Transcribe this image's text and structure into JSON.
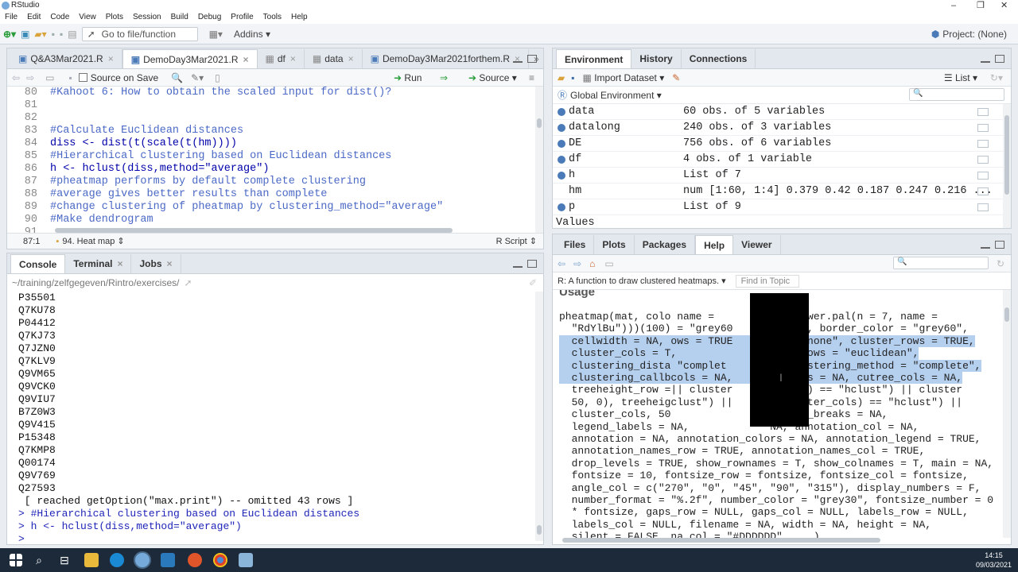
{
  "window": {
    "title": "RStudio"
  },
  "menu": [
    "File",
    "Edit",
    "Code",
    "View",
    "Plots",
    "Session",
    "Build",
    "Debug",
    "Profile",
    "Tools",
    "Help"
  ],
  "toolbar": {
    "goto_placeholder": "Go to file/function",
    "addins": "Addins",
    "project": "Project: (None)"
  },
  "editor": {
    "tabs": [
      "Q&A3Mar2021.R",
      "DemoDay3Mar2021.R",
      "df",
      "data",
      "DemoDay3Mar2021forthem.R"
    ],
    "source_on_save": "Source on Save",
    "run": "Run",
    "source": "Source",
    "lines": [
      {
        "n": "80",
        "text": "#Kahoot 6: How to obtain the scaled input for dist()?",
        "kind": "comment"
      },
      {
        "n": "81",
        "text": "",
        "kind": "code"
      },
      {
        "n": "82",
        "text": "",
        "kind": "code"
      },
      {
        "n": "83",
        "text": "#Calculate Euclidean distances",
        "kind": "comment"
      },
      {
        "n": "84",
        "text": "diss <- dist(t(scale(t(hm))))",
        "kind": "code"
      },
      {
        "n": "85",
        "text": "#Hierarchical clustering based on Euclidean distances",
        "kind": "comment"
      },
      {
        "n": "86",
        "text": "h <- hclust(diss,method=\"average\")",
        "kind": "code"
      },
      {
        "n": "87",
        "text": "#pheatmap performs by default complete clustering",
        "kind": "comment"
      },
      {
        "n": "88",
        "text": "#average gives better results than complete",
        "kind": "comment"
      },
      {
        "n": "89",
        "text": "#change clustering of pheatmap by clustering_method=\"average\"",
        "kind": "comment"
      },
      {
        "n": "90",
        "text": "#Make dendrogram",
        "kind": "comment"
      },
      {
        "n": "91",
        "text": "",
        "kind": "code"
      }
    ],
    "status_pos": "87:1",
    "status_section": "94. Heat map",
    "status_type": "R Script"
  },
  "console": {
    "tabs": [
      "Console",
      "Terminal",
      "Jobs"
    ],
    "path": "~/training/zelfgegeven/Rintro/exercises/",
    "lines": [
      {
        "text": "P35501",
        "kind": "out"
      },
      {
        "text": "Q7KU78",
        "kind": "out"
      },
      {
        "text": "P04412",
        "kind": "out"
      },
      {
        "text": "Q7KJ73",
        "kind": "out"
      },
      {
        "text": "Q7JZN0",
        "kind": "out"
      },
      {
        "text": "Q7KLV9",
        "kind": "out"
      },
      {
        "text": "Q9VM65",
        "kind": "out"
      },
      {
        "text": "Q9VCK0",
        "kind": "out"
      },
      {
        "text": "Q9VIU7",
        "kind": "out"
      },
      {
        "text": "B7Z0W3",
        "kind": "out"
      },
      {
        "text": "Q9V415",
        "kind": "out"
      },
      {
        "text": "P15348",
        "kind": "out"
      },
      {
        "text": "Q7KMP8",
        "kind": "out"
      },
      {
        "text": "Q00174",
        "kind": "out"
      },
      {
        "text": "Q9V769",
        "kind": "out"
      },
      {
        "text": "Q27593",
        "kind": "out"
      },
      {
        "text": " [ reached getOption(\"max.print\") -- omitted 43 rows ]",
        "kind": "out"
      },
      {
        "text": "> #Hierarchical clustering based on Euclidean distances",
        "kind": "in"
      },
      {
        "text": "> h <- hclust(diss,method=\"average\")",
        "kind": "in"
      },
      {
        "text": "> ",
        "kind": "in"
      }
    ]
  },
  "environment": {
    "tabs": [
      "Environment",
      "History",
      "Connections"
    ],
    "import_dataset": "Import Dataset",
    "list_mode": "List",
    "scope": "Global Environment",
    "rows": [
      {
        "name": "data",
        "value": "60 obs. of 5 variables"
      },
      {
        "name": "datalong",
        "value": "240 obs. of 3 variables"
      },
      {
        "name": "DE",
        "value": "756 obs. of 6 variables"
      },
      {
        "name": "df",
        "value": "4 obs. of 1 variable"
      },
      {
        "name": "h",
        "value": "List of 7"
      },
      {
        "name": "hm",
        "value": "num [1:60, 1:4] 0.379 0.42 0.187 0.247 0.216 ..."
      },
      {
        "name": "p",
        "value": "List of 9"
      }
    ],
    "values_header": "Values"
  },
  "help": {
    "tabs": [
      "Files",
      "Plots",
      "Packages",
      "Help",
      "Viewer"
    ],
    "topic": "R: A function to draw clustered heatmaps.",
    "find_placeholder": "Find in Topic",
    "section": "Usage",
    "lines": [
      "pheatmap(mat, colo name =        rev(brewer.pal(n = 7, name =",
      "  \"RdYlBu\")))(100) = \"grey60     ks = NA, border_color = \"grey60\",",
      "  cellwidth = NA, ows = TRUE       e = \"none\", cluster_rows = TRUE,",
      "  cluster_cols = T,               ance_rows = \"euclidean\",",
      "  clustering_dista \"complet       \", clustering_method = \"complete\",",
      "  clustering_callbcols = NA,      ee_rows = NA, cutree_cols = NA,",
      "  treeheight_row =|| cluster      r_rows) == \"hclust\") || cluster",
      "  50, 0), treeheigclust\") ||      e(cluster_cols) == \"hclust\") ||",
      "  cluster_cols, 50                legend_breaks = NA,",
      "  legend_labels = NA,             NA, annotation_col = NA,",
      "  annotation = NA, annotation_colors = NA, annotation_legend = TRUE,",
      "  annotation_names_row = TRUE, annotation_names_col = TRUE,",
      "  drop_levels = TRUE, show_rownames = T, show_colnames = T, main = NA,",
      "  fontsize = 10, fontsize_row = fontsize, fontsize_col = fontsize,",
      "  angle_col = c(\"270\", \"0\", \"45\", \"90\", \"315\"), display_numbers = F,",
      "  number_format = \"%.2f\", number_color = \"grey30\", fontsize_number = 0",
      "  * fontsize, gaps_row = NULL, gaps_col = NULL, labels_row = NULL,",
      "  labels_col = NULL, filename = NA, width = NA, height = NA,",
      "  silent = FALSE, na_col = \"#DDDDDD\", ...)"
    ]
  },
  "taskbar": {
    "time": "14:15",
    "date": "09/03/2021"
  }
}
